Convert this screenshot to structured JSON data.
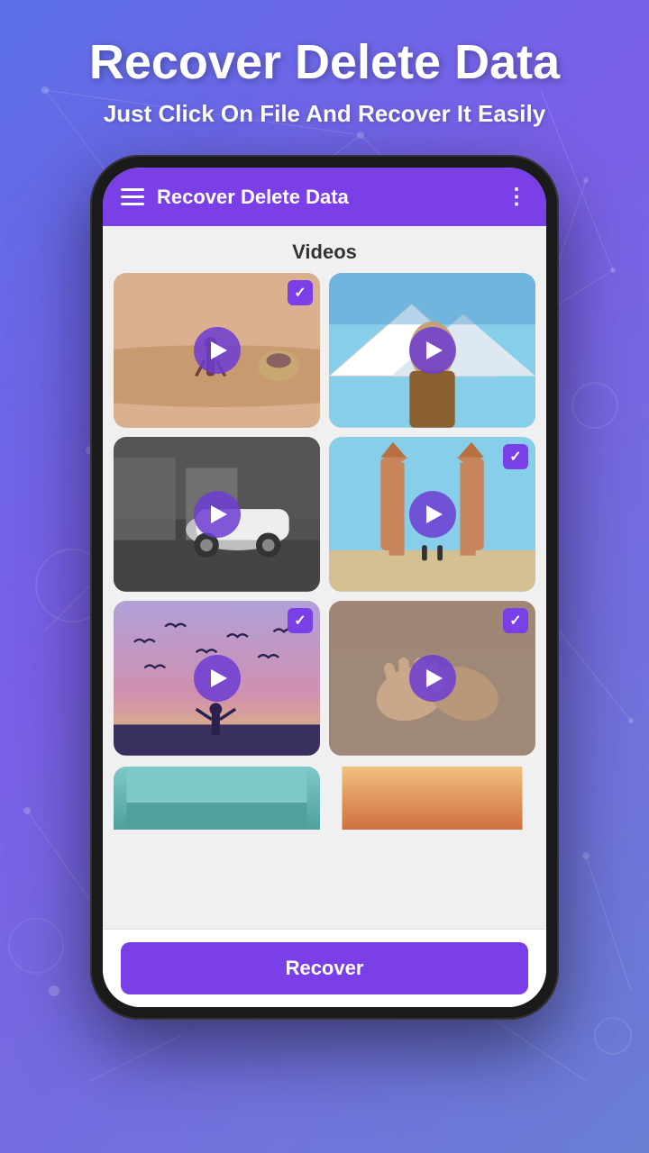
{
  "background": {
    "gradient_start": "#5b6fe6",
    "gradient_end": "#6a7fd4"
  },
  "header": {
    "main_title": "Recover Delete Data",
    "sub_title": "Just Click On File And Recover It Easily"
  },
  "app_bar": {
    "title": "Recover Delete Data",
    "menu_icon": "☰",
    "more_icon": "⋮"
  },
  "content": {
    "section_title": "Videos",
    "videos": [
      {
        "id": 1,
        "checked": true,
        "theme": "desert-walk"
      },
      {
        "id": 2,
        "checked": false,
        "theme": "snow-portrait"
      },
      {
        "id": 3,
        "checked": false,
        "theme": "car-bw"
      },
      {
        "id": 4,
        "checked": true,
        "theme": "arch-monument"
      },
      {
        "id": 5,
        "checked": true,
        "theme": "birds-silhouette"
      },
      {
        "id": 6,
        "checked": true,
        "theme": "hands-closeup"
      },
      {
        "id": 7,
        "checked": false,
        "theme": "partial-teal"
      },
      {
        "id": 8,
        "checked": false,
        "theme": "partial-sunset"
      }
    ]
  },
  "bottom_bar": {
    "recover_button_label": "Recover"
  }
}
